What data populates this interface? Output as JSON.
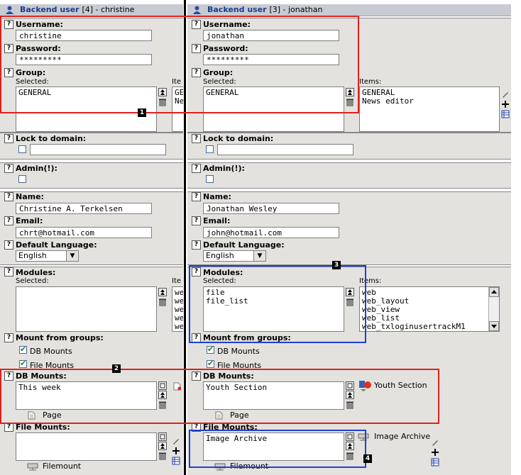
{
  "left": {
    "title_main": "Backend user",
    "title_sub": "[4] - christine",
    "username_label": "Username:",
    "username_value": "christine",
    "password_label": "Password:",
    "password_value": "*********",
    "group_label": "Group:",
    "selected_label": "Selected:",
    "items_label": "Ite",
    "group_selected": "GENERAL",
    "group_items": "GE\nNe",
    "lock_label": "Lock to domain:",
    "admin_label": "Admin(!):",
    "name_label": "Name:",
    "name_value": "Christine A. Terkelsen",
    "email_label": "Email:",
    "email_value": "chrt@hotmail.com",
    "lang_label": "Default Language:",
    "lang_value": "English",
    "modules_label": "Modules:",
    "modules_items": "we\nwe\nwe\nwe\nwe",
    "mount_groups_label": "Mount from groups:",
    "dbmounts_check": "DB Mounts",
    "filemounts_check": "File Mounts",
    "dbmounts_label": "DB Mounts:",
    "dbmounts_value": "This week",
    "page_label": "Page",
    "filemounts_label": "File Mounts:",
    "filemount_label": "Filemount"
  },
  "right": {
    "title_main": "Backend user",
    "title_sub": "[3] - jonathan",
    "username_label": "Username:",
    "username_value": "jonathan",
    "password_label": "Password:",
    "password_value": "*********",
    "group_label": "Group:",
    "selected_label": "Selected:",
    "items_label": "Items:",
    "group_selected": "GENERAL",
    "group_items": "GENERAL\nNews editor",
    "lock_label": "Lock to domain:",
    "admin_label": "Admin(!):",
    "name_label": "Name:",
    "name_value": "Jonathan Wesley",
    "email_label": "Email:",
    "email_value": "john@hotmail.com",
    "lang_label": "Default Language:",
    "lang_value": "English",
    "modules_label": "Modules:",
    "modules_selected": "file\nfile_list",
    "modules_items": "web\nweb_layout\nweb_view\nweb_list\nweb_txloginusertrackM1",
    "mount_groups_label": "Mount from groups:",
    "dbmounts_check": "DB Mounts",
    "filemounts_check": "File Mounts",
    "dbmounts_label": "DB Mounts:",
    "dbmounts_value": "Youth Section",
    "dbmounts_item": "Youth Section",
    "page_label": "Page",
    "filemounts_label": "File Mounts:",
    "filemounts_value": "Image Archive",
    "filemounts_item": "Image Archive",
    "filemount_label": "Filemount"
  },
  "annotations": {
    "n1": "1",
    "n2": "2",
    "n3": "3",
    "n4": "4"
  },
  "colors": {
    "red": "#e02020",
    "blue": "#2040d0",
    "section_bg": "#e4e2de",
    "title_bg": "#c8cbd2"
  }
}
